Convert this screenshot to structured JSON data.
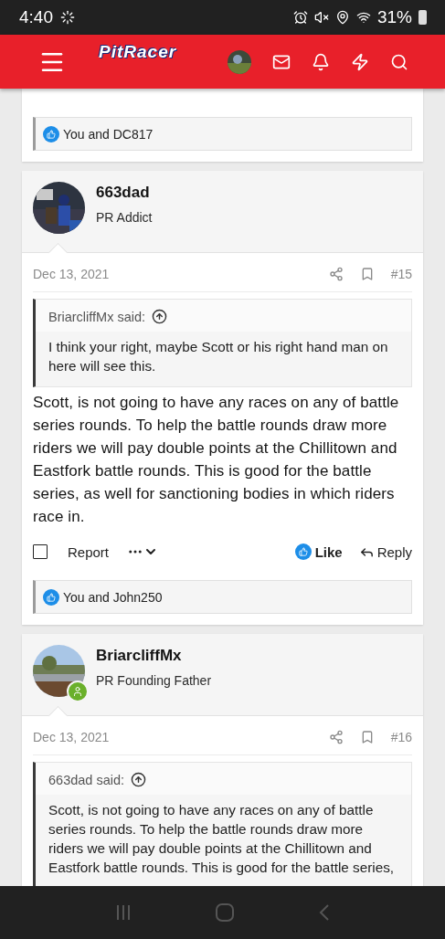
{
  "status_bar": {
    "time": "4:40",
    "battery": "31%"
  },
  "header": {
    "logo": "PitRacer"
  },
  "posts": [
    {
      "kind": "likes_only",
      "likes": "You and DC817"
    },
    {
      "kind": "post",
      "author": "663dad",
      "role": "PR Addict",
      "online": false,
      "date": "Dec 13, 2021",
      "number": "#15",
      "quote": {
        "source": "BriarcliffMx said:",
        "text": "I think your right, maybe Scott or his right hand man on here will see this."
      },
      "body": "Scott, is not going to have any races on any of battle series rounds. To help the battle rounds draw more riders we will pay double points at the Chillitown and Eastfork battle rounds. This is good for the battle series, as well for sanctioning bodies in which riders race in.",
      "actions": {
        "checked": false,
        "report": "Report",
        "like": "Like",
        "reply": "Reply",
        "liked": true
      },
      "likes": "You and John250"
    },
    {
      "kind": "post",
      "author": "BriarcliffMx",
      "role": "PR Founding Father",
      "online": true,
      "date": "Dec 13, 2021",
      "number": "#16",
      "quote": {
        "source": "663dad said:",
        "text": "Scott, is not going to have any races on any of battle series rounds. To help the battle rounds draw more riders we will pay double points at the Chillitown and Eastfork battle rounds. This is good for the battle series,"
      }
    }
  ]
}
